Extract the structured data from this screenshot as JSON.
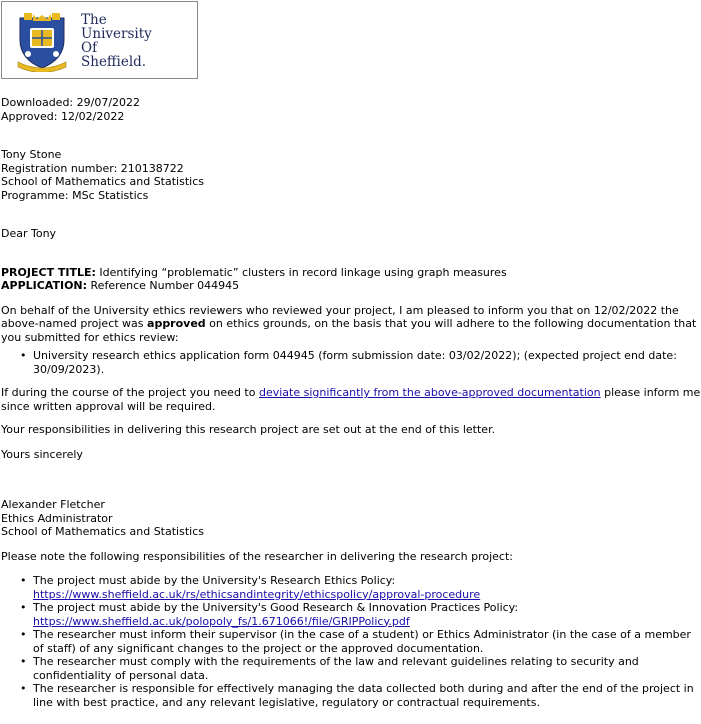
{
  "logo": {
    "line1": "The",
    "line2": "University",
    "line3": "Of",
    "line4": "Sheffield.",
    "colors": {
      "shield_blue": "#2a4ea0",
      "gold": "#e8b921",
      "navy": "#1f2a5a"
    }
  },
  "dates": {
    "downloaded": "Downloaded: 29/07/2022",
    "approved": "Approved: 12/02/2022"
  },
  "recipient": {
    "name": "Tony Stone",
    "registration": "Registration number: 210138722",
    "school": "School of Mathematics and Statistics",
    "programme": "Programme: MSc Statistics"
  },
  "greeting": "Dear Tony",
  "project": {
    "title_label": "PROJECT TITLE:",
    "title_value": " Identifying “problematic” clusters in record linkage using graph measures",
    "application_label": "APPLICATION:",
    "application_value": " Reference Number 044945"
  },
  "body": {
    "para1_part1": "On behalf of the University ethics reviewers who reviewed your project, I am pleased to inform you that on 12/02/2022 the above-named project was ",
    "para1_bold": "approved",
    "para1_part2": " on ethics grounds, on the basis that you will adhere to the following documentation that you submitted for ethics review:",
    "documents": [
      "University research ethics application form 044945 (form submission date: 03/02/2022); (expected project end date: 30/09/2023)."
    ],
    "para2_part1": "If during the course of the project you need to ",
    "para2_link": "deviate significantly from the above-approved documentation",
    "para2_part2": " please inform me since written approval will be required.",
    "para3": "Your responsibilities in delivering this research project are set out at the end of this letter.",
    "closing": "Yours sincerely"
  },
  "signature": {
    "name": "Alexander Fletcher",
    "title": "Ethics Administrator",
    "school": "School of Mathematics and Statistics"
  },
  "responsibilities": {
    "intro": "Please note the following responsibilities of the researcher in delivering the research project:",
    "item1_text": "The project must abide by the University's Research Ethics Policy:",
    "item1_link": "https://www.sheffield.ac.uk/rs/ethicsandintegrity/ethicspolicy/approval-procedure",
    "item2_text": "The project must abide by the University's Good Research & Innovation Practices Policy:",
    "item2_link": "https://www.sheffield.ac.uk/polopoly_fs/1.671066!/file/GRIPPolicy.pdf",
    "item3": "The researcher must inform their supervisor (in the case of a student) or Ethics Administrator (in the case of a member of staff) of any significant changes to the project or the approved documentation.",
    "item4": "The researcher must comply with the requirements of the law and relevant guidelines relating to security and confidentiality of personal data.",
    "item5": "The researcher is responsible for effectively managing the data collected both during and after the end of the project in line with best practice, and any relevant legislative, regulatory or contractual requirements."
  }
}
